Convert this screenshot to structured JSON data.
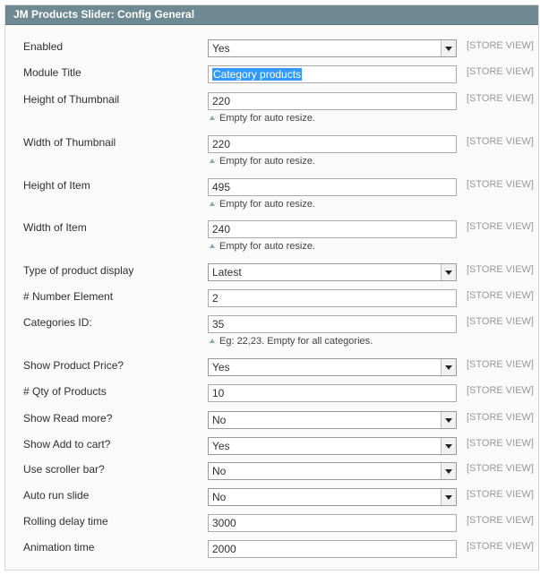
{
  "panel": {
    "title": "JM Products Slider: Config General",
    "scope_label": "[STORE VIEW]"
  },
  "fields": [
    {
      "label": "Enabled",
      "value": "Yes",
      "type": "select"
    },
    {
      "label": "Module Title",
      "value": "Category products",
      "type": "text",
      "text_selected": true
    },
    {
      "label": "Height of Thumbnail",
      "value": "220",
      "type": "text",
      "note": "Empty for auto resize."
    },
    {
      "label": "Width of Thumbnail",
      "value": "220",
      "type": "text",
      "note": "Empty for auto resize."
    },
    {
      "label": "Height of Item",
      "value": "495",
      "type": "text",
      "note": "Empty for auto resize."
    },
    {
      "label": "Width of Item",
      "value": "240",
      "type": "text",
      "note": "Empty for auto resize."
    },
    {
      "label": "Type of product display",
      "value": "Latest",
      "type": "select"
    },
    {
      "label": "# Number Element",
      "value": "2",
      "type": "text"
    },
    {
      "label": "Categories ID:",
      "value": "35",
      "type": "text",
      "note": "Eg: 22,23. Empty for all categories."
    },
    {
      "label": "Show Product Price?",
      "value": "Yes",
      "type": "select"
    },
    {
      "label": "# Qty of Products",
      "value": "10",
      "type": "text"
    },
    {
      "label": "Show Read more?",
      "value": "No",
      "type": "select"
    },
    {
      "label": "Show Add to cart?",
      "value": "Yes",
      "type": "select"
    },
    {
      "label": "Use scroller bar?",
      "value": "No",
      "type": "select"
    },
    {
      "label": "Auto run slide",
      "value": "No",
      "type": "select"
    },
    {
      "label": "Rolling delay time",
      "value": "3000",
      "type": "text"
    },
    {
      "label": "Animation time",
      "value": "2000",
      "type": "text"
    }
  ]
}
